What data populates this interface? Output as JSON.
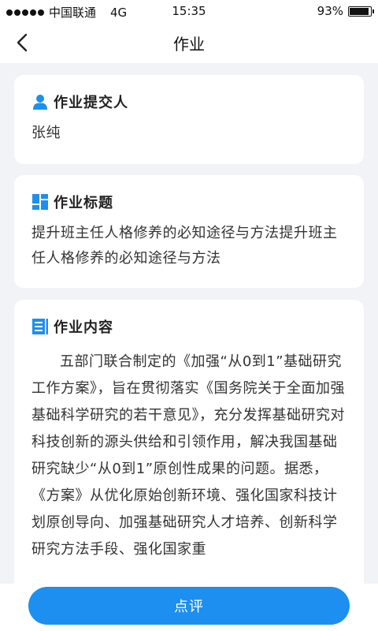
{
  "status_bar": {
    "carrier": "中国联通",
    "network": "4G",
    "time": "15:35",
    "battery_text": "93%",
    "battery_level": 0.93
  },
  "nav": {
    "title": "作业"
  },
  "submitter": {
    "label": "作业提交人",
    "value": "张纯",
    "icon": "user-icon"
  },
  "homework_title": {
    "label": "作业标题",
    "value": "提升班主任人格修养的必知途径与方法提升班主任人格修养的必知途径与方法",
    "icon": "grid-icon"
  },
  "homework_content": {
    "label": "作业内容",
    "value": "五部门联合制定的《加强“从0到1”基础研究工作方案》，旨在贯彻落实《国务院关于全面加强基础科学研究的若干意见》，充分发挥基础研究对科技创新的源头供给和引领作用，解决我国基础研究缺少“从0到1”原创性成果的问题。据悉，《方案》从优化原始创新环境、强化国家科技计划原创导向、加强基础研究人才培养、创新科学研究方法手段、强化国家重",
    "icon": "document-icon"
  },
  "actions": {
    "review_label": "点评"
  },
  "colors": {
    "accent": "#1c8ff0",
    "background": "#f2f3f7"
  }
}
